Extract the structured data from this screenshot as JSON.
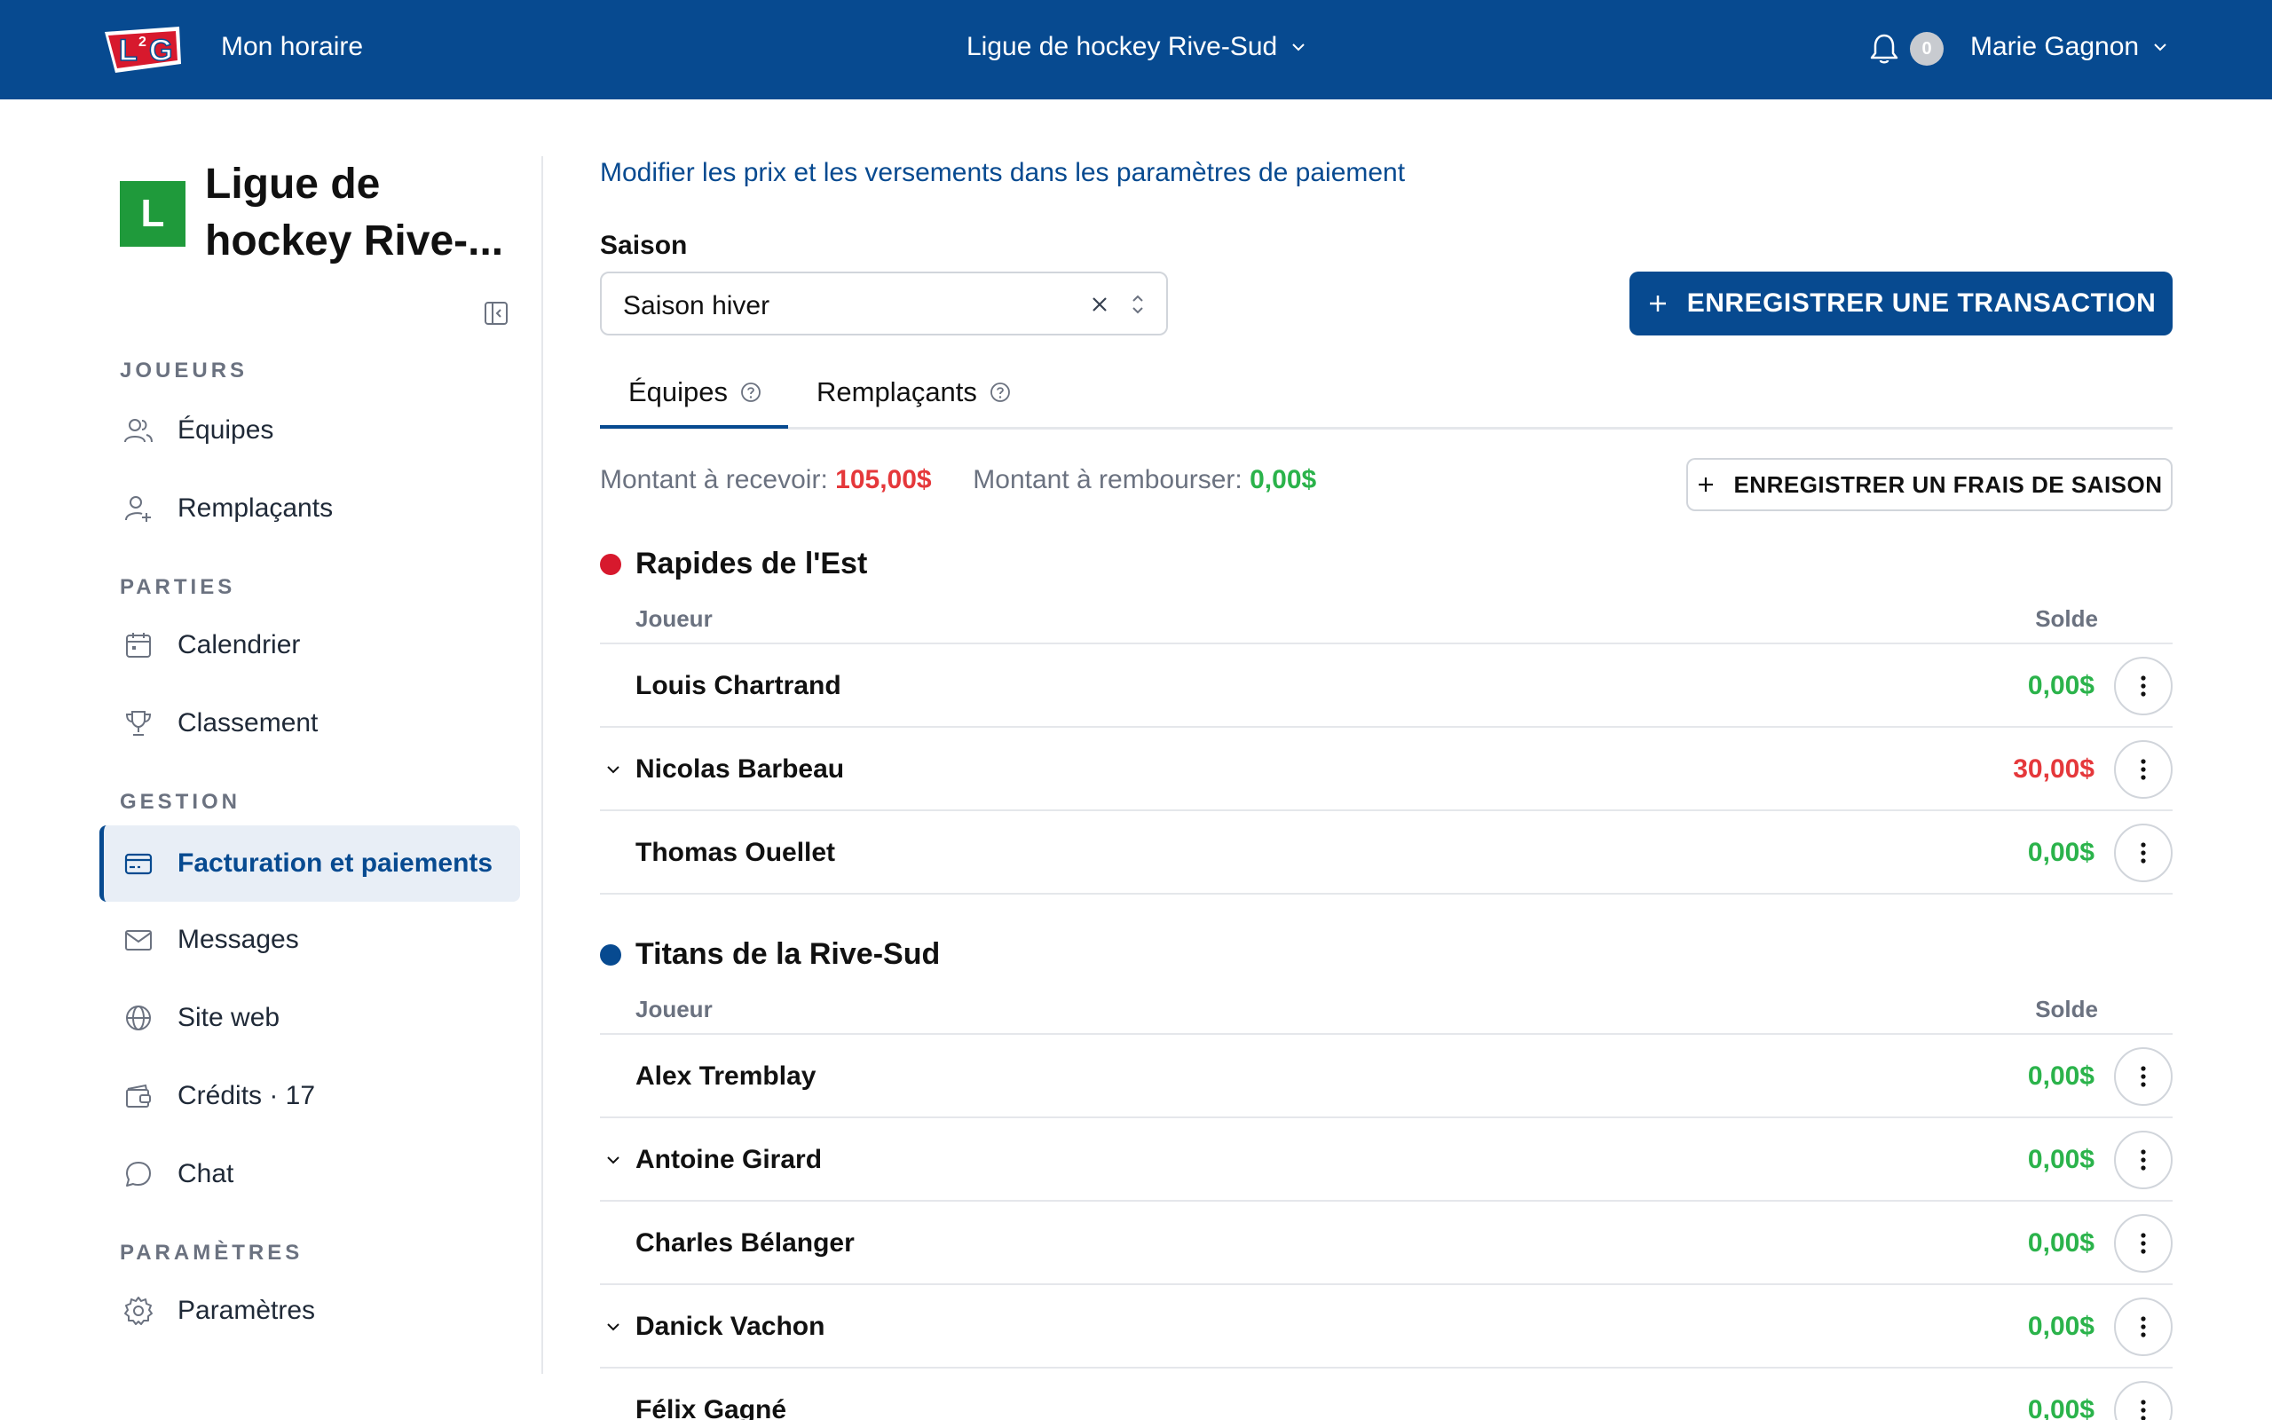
{
  "topbar": {
    "logo_text": "L2G",
    "schedule": "Mon horaire",
    "league": "Ligue de hockey Rive-Sud",
    "notifications": "0",
    "user": "Marie Gagnon"
  },
  "sidebar": {
    "org_initial": "L",
    "org_name": "Ligue de hockey Rive-...",
    "sections": {
      "players": "JOUEURS",
      "games": "PARTIES",
      "management": "GESTION",
      "settings": "PARAMÈTRES"
    },
    "items": {
      "teams": "Équipes",
      "substitutes": "Remplaçants",
      "calendar": "Calendrier",
      "standings": "Classement",
      "billing": "Facturation et paiements",
      "messages": "Messages",
      "website": "Site web",
      "credits": "Crédits · 17",
      "chat": "Chat",
      "settings": "Paramètres"
    }
  },
  "main": {
    "modify_link": "Modifier les prix et les versements dans les paramètres de paiement",
    "season_label": "Saison",
    "season_value": "Saison hiver",
    "record_transaction": "ENREGISTRER UNE TRANSACTION",
    "tabs": [
      "Équipes",
      "Remplaçants"
    ],
    "amount_receive_label": "Montant à recevoir:",
    "amount_receive_value": "105,00$",
    "amount_refund_label": "Montant à rembourser:",
    "amount_refund_value": "0,00$",
    "record_season_fee": "ENREGISTRER UN FRAIS DE SAISON",
    "col_player": "Joueur",
    "col_balance": "Solde",
    "teams": [
      {
        "name": "Rapides de l'Est",
        "color": "#d7192d",
        "players": [
          {
            "name": "Louis Chartrand",
            "balance": "0,00$",
            "status": "green",
            "expandable": false
          },
          {
            "name": "Nicolas Barbeau",
            "balance": "30,00$",
            "status": "red",
            "expandable": true
          },
          {
            "name": "Thomas Ouellet",
            "balance": "0,00$",
            "status": "green",
            "expandable": false
          }
        ]
      },
      {
        "name": "Titans de la Rive-Sud",
        "color": "#074a90",
        "players": [
          {
            "name": "Alex Tremblay",
            "balance": "0,00$",
            "status": "green",
            "expandable": false
          },
          {
            "name": "Antoine Girard",
            "balance": "0,00$",
            "status": "green",
            "expandable": true
          },
          {
            "name": "Charles Bélanger",
            "balance": "0,00$",
            "status": "green",
            "expandable": false
          },
          {
            "name": "Danick Vachon",
            "balance": "0,00$",
            "status": "green",
            "expandable": true
          },
          {
            "name": "Félix Gagné",
            "balance": "0,00$",
            "status": "green",
            "expandable": false
          }
        ]
      }
    ]
  },
  "colors": {
    "brand": "#074a90",
    "positive": "#2bb34b",
    "negative": "#e5383b"
  }
}
